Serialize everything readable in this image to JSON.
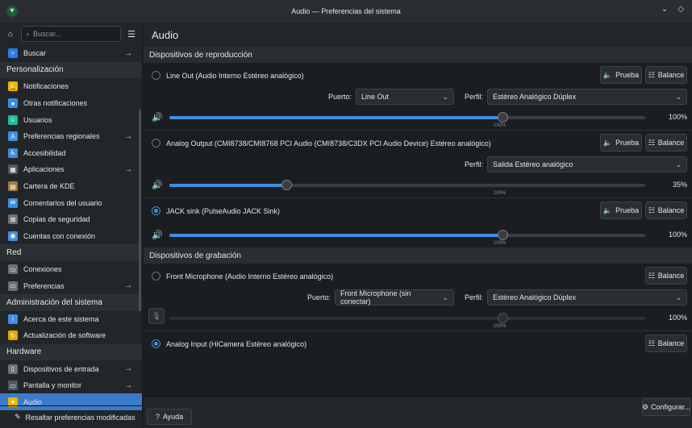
{
  "window": {
    "title": "Audio — Preferencias del sistema"
  },
  "sidebar": {
    "search_placeholder": "Buscar...",
    "items": [
      {
        "type": "item",
        "label": "Buscar",
        "icon": "search-icon",
        "color": "#2b7de9",
        "arrow": true
      },
      {
        "type": "category",
        "label": "Personalización"
      },
      {
        "type": "item",
        "label": "Notificaciones",
        "icon": "bell-icon",
        "color": "#f0b400",
        "arrow": false
      },
      {
        "type": "item",
        "label": "Otras notificaciones",
        "icon": "notification-icon",
        "color": "#3d8ee6",
        "arrow": false
      },
      {
        "type": "item",
        "label": "Usuarios",
        "icon": "users-icon",
        "color": "#1abc9c",
        "arrow": false
      },
      {
        "type": "item",
        "label": "Preferencias regionales",
        "icon": "language-icon",
        "color": "#3d8ee6",
        "arrow": true
      },
      {
        "type": "item",
        "label": "Accesibilidad",
        "icon": "accessibility-icon",
        "color": "#3d8ee6",
        "arrow": false
      },
      {
        "type": "item",
        "label": "Aplicaciones",
        "icon": "applications-icon",
        "color": "#4c5a66",
        "arrow": true
      },
      {
        "type": "item",
        "label": "Cartera de KDE",
        "icon": "wallet-icon",
        "color": "#a27c3c",
        "arrow": false
      },
      {
        "type": "item",
        "label": "Comentarios del usuario",
        "icon": "feedback-icon",
        "color": "#3d8ee6",
        "arrow": false
      },
      {
        "type": "item",
        "label": "Copias de seguridad",
        "icon": "backup-icon",
        "color": "#6c7278",
        "arrow": false
      },
      {
        "type": "item",
        "label": "Cuentas con conexión",
        "icon": "online-accounts-icon",
        "color": "#3d8ee6",
        "arrow": false
      },
      {
        "type": "category",
        "label": "Red"
      },
      {
        "type": "item",
        "label": "Conexiones",
        "icon": "network-icon",
        "color": "#6c7278",
        "arrow": false
      },
      {
        "type": "item",
        "label": "Preferencias",
        "icon": "network-settings-icon",
        "color": "#6c7278",
        "arrow": true
      },
      {
        "type": "category",
        "label": "Administración del sistema"
      },
      {
        "type": "item",
        "label": "Acerca de este sistema",
        "icon": "info-icon",
        "color": "#3d8ee6",
        "arrow": false
      },
      {
        "type": "item",
        "label": "Actualización de software",
        "icon": "update-icon",
        "color": "#e6a700",
        "arrow": false
      },
      {
        "type": "category",
        "label": "Hardware"
      },
      {
        "type": "item",
        "label": "Dispositivos de entrada",
        "icon": "mouse-icon",
        "color": "#6c7278",
        "arrow": true
      },
      {
        "type": "item",
        "label": "Pantalla y monitor",
        "icon": "monitor-icon",
        "color": "#4c5a66",
        "arrow": true
      },
      {
        "type": "item",
        "label": "Audio",
        "icon": "audio-icon",
        "color": "#f0b400",
        "arrow": false,
        "active": true
      }
    ],
    "bottom_label": "Resaltar preferencias modificadas"
  },
  "main": {
    "title": "Audio",
    "playback_section": "Dispositivos de reproducción",
    "recording_section": "Dispositivos de grabación",
    "test_label": "Prueba",
    "balance_label": "Balance",
    "port_label": "Puerto:",
    "profile_label": "Perfil:",
    "tick_100": "100%",
    "playback": [
      {
        "name": "Line Out (Audio Interno Estéreo analógico)",
        "selected": false,
        "port": "Line Out",
        "profile": "Estéreo Analógico Dúplex",
        "volume": "100%",
        "level": 100
      },
      {
        "name": "Analog Output (CMI8738/CMI8768 PCI Audio (CMI8738/C3DX PCI Audio Device) Estéreo analógico)",
        "selected": false,
        "profile": "Salida Estéreo analógico",
        "volume": "35%",
        "level": 35
      },
      {
        "name": "JACK sink (PulseAudio JACK Sink)",
        "selected": true,
        "volume": "100%",
        "level": 100
      }
    ],
    "recording": [
      {
        "name": "Front Microphone (Audio Interno Estéreo analógico)",
        "selected": false,
        "port": "Front Microphone (sin conectar)",
        "profile": "Estéreo Analógico Dúplex",
        "volume": "100%",
        "level": 100
      },
      {
        "name": "Analog Input (HiCamera Estéreo analógico)",
        "selected": true
      }
    ],
    "configure_label": "Configurar...",
    "help_label": "Ayuda"
  }
}
